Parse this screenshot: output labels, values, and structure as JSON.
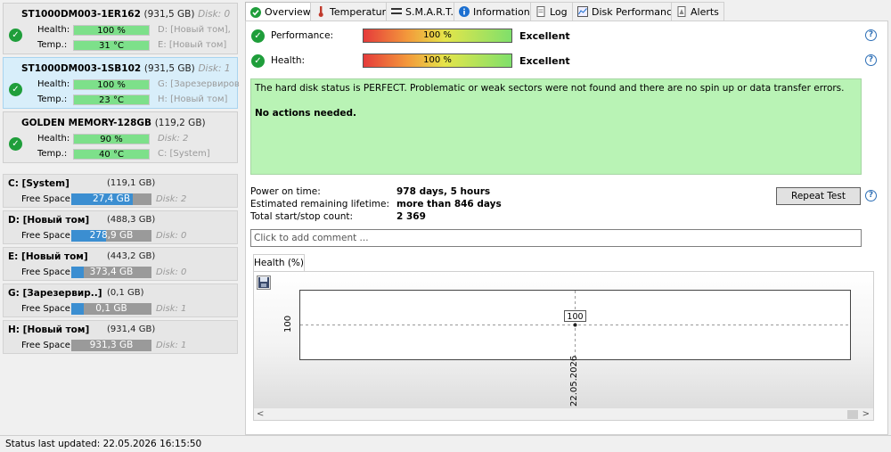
{
  "disks": [
    {
      "name": "ST1000DM003-1ER162",
      "size": "(931,5 GB)",
      "disk": "Disk: 0",
      "health_label": "Health:",
      "health": "100 %",
      "health_right": "D: [Новый том],",
      "temp_label": "Temp.:",
      "temp": "31 °C",
      "temp_right": "E: [Новый том]"
    },
    {
      "name": "ST1000DM003-1SB102",
      "size": "(931,5 GB)",
      "disk": "Disk: 1",
      "health_label": "Health:",
      "health": "100 %",
      "health_right": "G: [Зарезервирован",
      "temp_label": "Temp.:",
      "temp": "23 °C",
      "temp_right": "H: [Новый том]"
    },
    {
      "name": "GOLDEN MEMORY-128GB",
      "size": "(119,2 GB)",
      "disk": "",
      "health_label": "Health:",
      "health": "90 %",
      "health_right": "Disk: 2",
      "temp_label": "Temp.:",
      "temp": "40 °C",
      "temp_right": "C: [System]"
    }
  ],
  "partitions": [
    {
      "name": "C: [System]",
      "size": "(119,1 GB)",
      "free_label": "Free Space",
      "free": "27,4 GB",
      "free_fraction": 0.77,
      "disk": "Disk: 2"
    },
    {
      "name": "D: [Новый том]",
      "size": "(488,3 GB)",
      "free_label": "Free Space",
      "free": "278,9 GB",
      "free_fraction": 0.43,
      "disk": "Disk: 0"
    },
    {
      "name": "E: [Новый том]",
      "size": "(443,2 GB)",
      "free_label": "Free Space",
      "free": "373,4 GB",
      "free_fraction": 0.16,
      "disk": "Disk: 0"
    },
    {
      "name": "G: [Зарезервир..]",
      "size": "(0,1 GB)",
      "free_label": "Free Space",
      "free": "0,1 GB",
      "free_fraction": 0.15,
      "disk": "Disk: 1"
    },
    {
      "name": "H: [Новый том]",
      "size": "(931,4 GB)",
      "free_label": "Free Space",
      "free": "931,3 GB",
      "free_fraction": 0.0,
      "disk": "Disk: 1"
    }
  ],
  "tabs": [
    {
      "label": "Overview",
      "icon": "check-icon",
      "active": true
    },
    {
      "label": "Temperature",
      "icon": "thermometer-icon"
    },
    {
      "label": "S.M.A.R.T.",
      "icon": "smart-icon"
    },
    {
      "label": "Information",
      "icon": "info-icon"
    },
    {
      "label": "Log",
      "icon": "log-icon"
    },
    {
      "label": "Disk Performance",
      "icon": "performance-icon"
    },
    {
      "label": "Alerts",
      "icon": "alerts-icon"
    }
  ],
  "overview": {
    "performance_label": "Performance:",
    "performance_value": "100 %",
    "performance_verdict": "Excellent",
    "health_label": "Health:",
    "health_value": "100 %",
    "health_verdict": "Excellent",
    "status_line1": "The hard disk status is PERFECT. Problematic or weak sectors were not found and there are no spin up or data transfer errors.",
    "status_line2": "No actions needed.",
    "power_on_label": "Power on time:",
    "power_on_value": "978 days, 5 hours",
    "lifetime_label": "Estimated remaining lifetime:",
    "lifetime_value": "more than 846 days",
    "startstop_label": "Total start/stop count:",
    "startstop_value": "2 369",
    "repeat_button": "Repeat Test",
    "comment_placeholder": "Click to add comment ...",
    "chart_tab": "Health (%)"
  },
  "chart_data": {
    "type": "line",
    "x": [
      "22.05.2026"
    ],
    "series": [
      {
        "values": [
          100
        ]
      }
    ],
    "ylabel": "",
    "y_tick": "100",
    "data_label": "100"
  },
  "status_bar": "Status last updated: 22.05.2026 16:15:50",
  "colors": {
    "ok_green": "#1f9e3b",
    "health_bar": "#7de08a",
    "status_box": "#b9f3b5",
    "free_fill": "#3b8ed1"
  }
}
